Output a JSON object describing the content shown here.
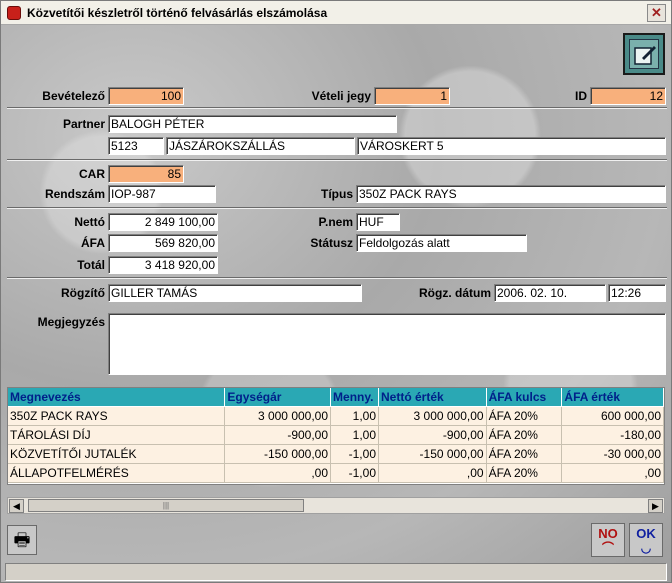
{
  "window": {
    "title": "Közvetítői készletről történő felvásárlás elszámolása",
    "close_glyph": "✕"
  },
  "header": {
    "bevetelezo_label": "Bevételező",
    "bevetelezo": "100",
    "veteli_jegy_label": "Vételi jegy",
    "veteli_jegy": "1",
    "id_label": "ID",
    "id": "12"
  },
  "partner": {
    "label": "Partner",
    "name": "BALOGH PÉTER",
    "zip": "5123",
    "city": "JÁSZÁROKSZÁLLÁS",
    "street": "VÁROSKERT 5"
  },
  "vehicle": {
    "car_label": "CAR",
    "car": "85",
    "rendszam_label": "Rendszám",
    "rendszam": "IOP-987",
    "tipus_label": "Típus",
    "tipus": "350Z PACK RAYS"
  },
  "amounts": {
    "netto_label": "Nettó",
    "netto": "2 849 100,00",
    "afa_label": "ÁFA",
    "afa": "569 820,00",
    "total_label": "Totál",
    "total": "3 418 920,00",
    "pnem_label": "P.nem",
    "pnem": "HUF",
    "status_label": "Státusz",
    "status": "Feldolgozás alatt"
  },
  "record": {
    "rogzito_label": "Rögzítő",
    "rogzito": "GILLER TAMÁS",
    "datum_label": "Rögz. dátum",
    "datum": "2006. 02. 10.",
    "time": "12:26"
  },
  "notes": {
    "label": "Megjegyzés",
    "value": ""
  },
  "grid": {
    "columns": [
      "Megnevezés",
      "Egységár",
      "Menny.",
      "Nettó érték",
      "ÁFA kulcs",
      "ÁFA érték"
    ],
    "rows": [
      [
        "350Z PACK RAYS",
        "3 000 000,00",
        "1,00",
        "3 000 000,00",
        "ÁFA 20%",
        "600 000,00"
      ],
      [
        "TÁROLÁSI DÍJ",
        "-900,00",
        "1,00",
        "-900,00",
        "ÁFA 20%",
        "-180,00"
      ],
      [
        "KÖZVETÍTŐI JUTALÉK",
        "-150 000,00",
        "-1,00",
        "-150 000,00",
        "ÁFA 20%",
        "-30 000,00"
      ],
      [
        "ÁLLAPOTFELMÉRÉS",
        ",00",
        "-1,00",
        ",00",
        "ÁFA 20%",
        ",00"
      ]
    ]
  },
  "scrollbar": {
    "left_glyph": "◀",
    "right_glyph": "▶",
    "thumb_grip": "|||"
  },
  "buttons": {
    "no_label": "NO",
    "ok_label": "OK",
    "print_glyph": "🖶"
  },
  "statusbar": {
    "text": ""
  }
}
